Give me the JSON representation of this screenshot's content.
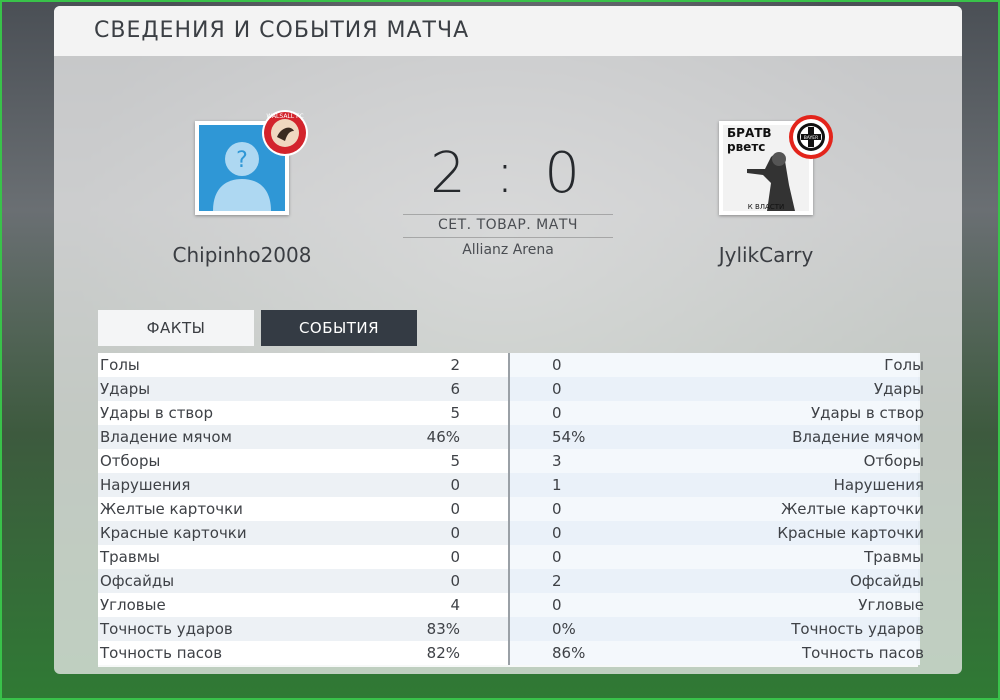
{
  "header": {
    "title": "СВЕДЕНИЯ И СОБЫТИЯ МАТЧА"
  },
  "home": {
    "name": "Chipinho2008",
    "avatar_icon": "unknown-user-avatar",
    "club_badge": "walsall-fc-badge",
    "badge_text": "WALSALL FC"
  },
  "away": {
    "name": "JylikCarry",
    "avatar_icon": "custom-photo-avatar",
    "club_badge": "bayer-leverkusen-badge",
    "avatar_text_top": "БРАТВ",
    "avatar_text_mid": "рветс",
    "avatar_text_bottom": "К ВЛАСТИ",
    "badge_text": "BAYER"
  },
  "match": {
    "score": "2 : 0",
    "type": "СЕТ. ТОВАР. МАТЧ",
    "stadium": "Allianz Arena"
  },
  "tabs": [
    {
      "label": "ФАКТЫ",
      "active": true
    },
    {
      "label": "СОБЫТИЯ",
      "active": false
    }
  ],
  "stats": [
    {
      "label": "Голы",
      "home": "2",
      "away": "0"
    },
    {
      "label": "Удары",
      "home": "6",
      "away": "0"
    },
    {
      "label": "Удары в створ",
      "home": "5",
      "away": "0"
    },
    {
      "label": "Владение мячом",
      "home": "46%",
      "away": "54%"
    },
    {
      "label": "Отборы",
      "home": "5",
      "away": "3"
    },
    {
      "label": "Нарушения",
      "home": "0",
      "away": "1"
    },
    {
      "label": "Желтые карточки",
      "home": "0",
      "away": "0"
    },
    {
      "label": "Красные карточки",
      "home": "0",
      "away": "0"
    },
    {
      "label": "Травмы",
      "home": "0",
      "away": "0"
    },
    {
      "label": "Офсайды",
      "home": "0",
      "away": "2"
    },
    {
      "label": "Угловые",
      "home": "4",
      "away": "0"
    },
    {
      "label": "Точность ударов",
      "home": "83%",
      "away": "0%"
    },
    {
      "label": "Точность пасов",
      "home": "82%",
      "away": "86%"
    }
  ],
  "colors": {
    "frame": "#39c24a",
    "tab_active_bg": "#f4f5f6",
    "tab_inactive_bg": "#343b44",
    "avatar_blue": "#2f97d6"
  }
}
